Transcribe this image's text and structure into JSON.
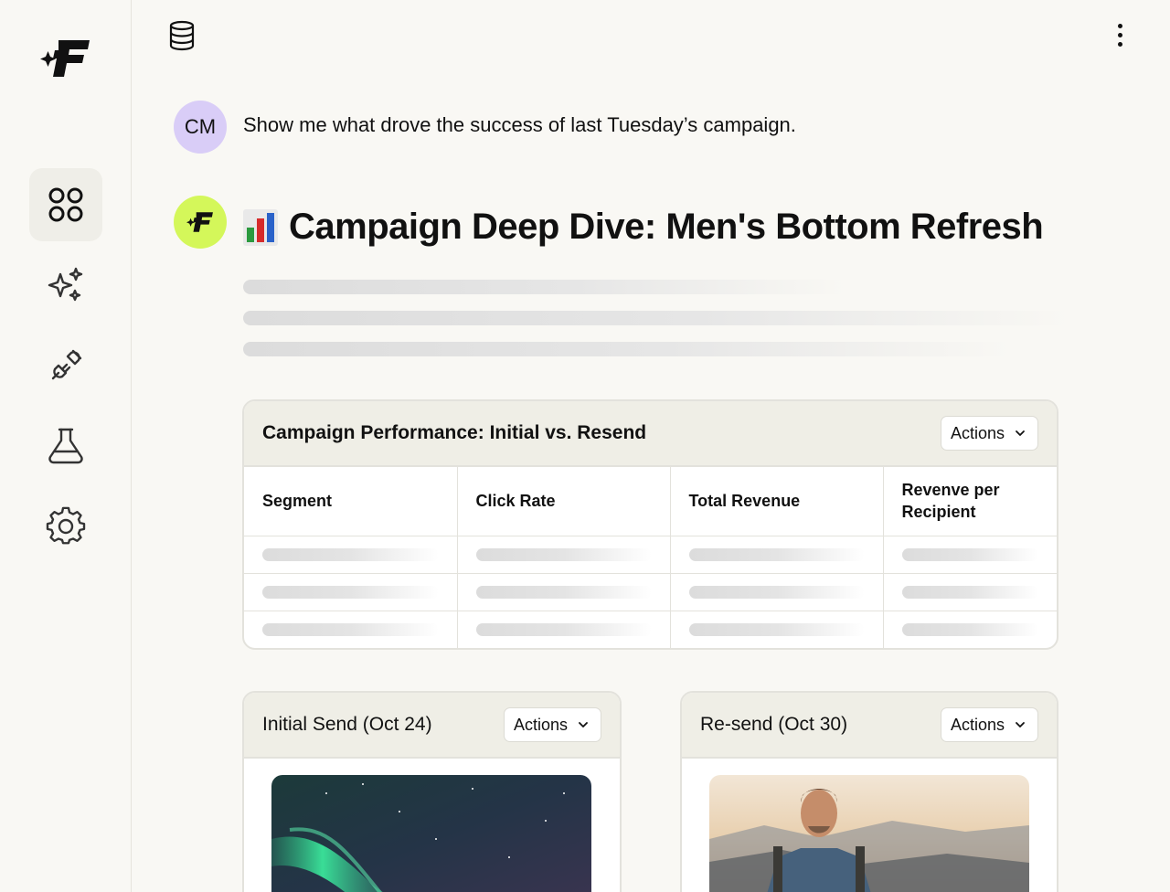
{
  "sidebar": {
    "items": [
      {
        "icon": "dashboard-grid-icon",
        "active": true
      },
      {
        "icon": "sparkles-icon",
        "active": false
      },
      {
        "icon": "plug-icon",
        "active": false
      },
      {
        "icon": "flask-icon",
        "active": false
      },
      {
        "icon": "gear-icon",
        "active": false
      }
    ]
  },
  "topbar": {
    "left_icon": "database-icon",
    "right_icon": "more-vertical-icon"
  },
  "chat": {
    "user": {
      "initials": "CM",
      "message": "Show me what drove the success of last Tuesday’s campaign."
    },
    "bot": {
      "emoji": "bar-chart-emoji",
      "title": "Campaign Deep Dive: Men's Bottom Refresh"
    }
  },
  "performance_card": {
    "title": "Campaign Performance: Initial vs. Resend",
    "actions_label": "Actions",
    "columns": [
      "Segment",
      "Click Rate",
      "Total Revenue",
      "Revenve per Recipient"
    ]
  },
  "initial_card": {
    "title": "Initial Send (Oct 24)",
    "actions_label": "Actions"
  },
  "resend_card": {
    "title": "Re-send (Oct 30)",
    "actions_label": "Actions"
  },
  "colors": {
    "background": "#f9f8f4",
    "user_avatar": "#d9cdf7",
    "bot_avatar": "#d4f75a",
    "card_header": "#efeee6"
  }
}
